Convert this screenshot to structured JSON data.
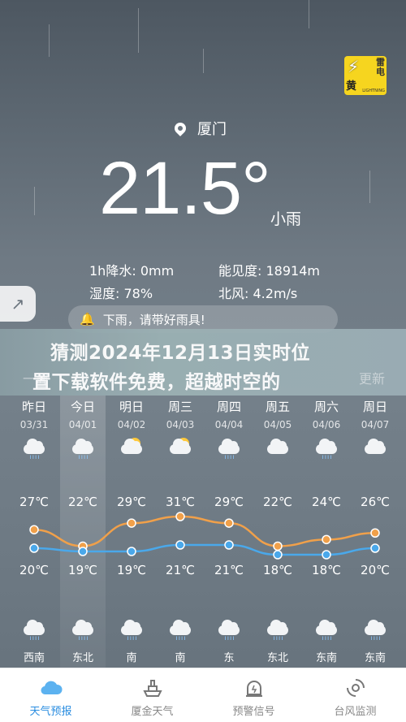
{
  "alert": {
    "line1": "雷",
    "line2": "电",
    "level": "黄",
    "sub": "LIGHTNING",
    "color": "#f6d51f"
  },
  "location": "厦门",
  "current": {
    "temp": "21.5°",
    "condition": "小雨"
  },
  "stats": {
    "rain_label": "1h降水:",
    "rain_value": "0mm",
    "humidity_label": "湿度:",
    "humidity_value": "78%",
    "visibility_label": "能见度:",
    "visibility_value": "18914m",
    "wind_label": "北风:",
    "wind_value": "4.2m/s"
  },
  "tip": "下雨，请带好雨具!",
  "banner": {
    "line1": "猜测2024年12月13日实时位",
    "line2": "置下载软件免费，超越时空的",
    "ghost_left": "一周",
    "ghost_right": "更新"
  },
  "days": [
    {
      "name": "昨日",
      "date": "03/31",
      "hi": "27℃",
      "lo": "20℃",
      "wind": "西南",
      "day_icon": "cloud-rain-icon"
    },
    {
      "name": "今日",
      "date": "04/01",
      "hi": "22℃",
      "lo": "19℃",
      "wind": "东北",
      "day_icon": "cloud-rain-icon"
    },
    {
      "name": "明日",
      "date": "04/02",
      "hi": "29℃",
      "lo": "19℃",
      "wind": "南",
      "day_icon": "partly-cloudy-icon"
    },
    {
      "name": "周三",
      "date": "04/03",
      "hi": "31℃",
      "lo": "21℃",
      "wind": "南",
      "day_icon": "partly-cloudy-icon"
    },
    {
      "name": "周四",
      "date": "04/04",
      "hi": "29℃",
      "lo": "21℃",
      "wind": "东",
      "day_icon": "cloud-rain-icon"
    },
    {
      "name": "周五",
      "date": "04/05",
      "hi": "22℃",
      "lo": "18℃",
      "wind": "东北",
      "day_icon": "cloud-icon"
    },
    {
      "name": "周六",
      "date": "04/06",
      "hi": "24℃",
      "lo": "18℃",
      "wind": "东南",
      "day_icon": "cloud-rain-icon"
    },
    {
      "name": "周日",
      "date": "04/07",
      "hi": "26℃",
      "lo": "20℃",
      "wind": "东南",
      "day_icon": "cloud-icon"
    }
  ],
  "chart_data": {
    "type": "line",
    "categories": [
      "03/31",
      "04/01",
      "04/02",
      "04/03",
      "04/04",
      "04/05",
      "04/06",
      "04/07"
    ],
    "series": [
      {
        "values": [
          27,
          22,
          29,
          31,
          29,
          22,
          24,
          26
        ],
        "color": "#f0a04a"
      },
      {
        "values": [
          20,
          19,
          19,
          21,
          21,
          18,
          18,
          20
        ],
        "color": "#4aa8ea"
      }
    ]
  },
  "tabs": [
    {
      "label": "天气预报",
      "icon": "cloud-icon"
    },
    {
      "label": "厦金天气",
      "icon": "ship-icon"
    },
    {
      "label": "预警信号",
      "icon": "alarm-icon"
    },
    {
      "label": "台风监测",
      "icon": "typhoon-icon"
    }
  ]
}
